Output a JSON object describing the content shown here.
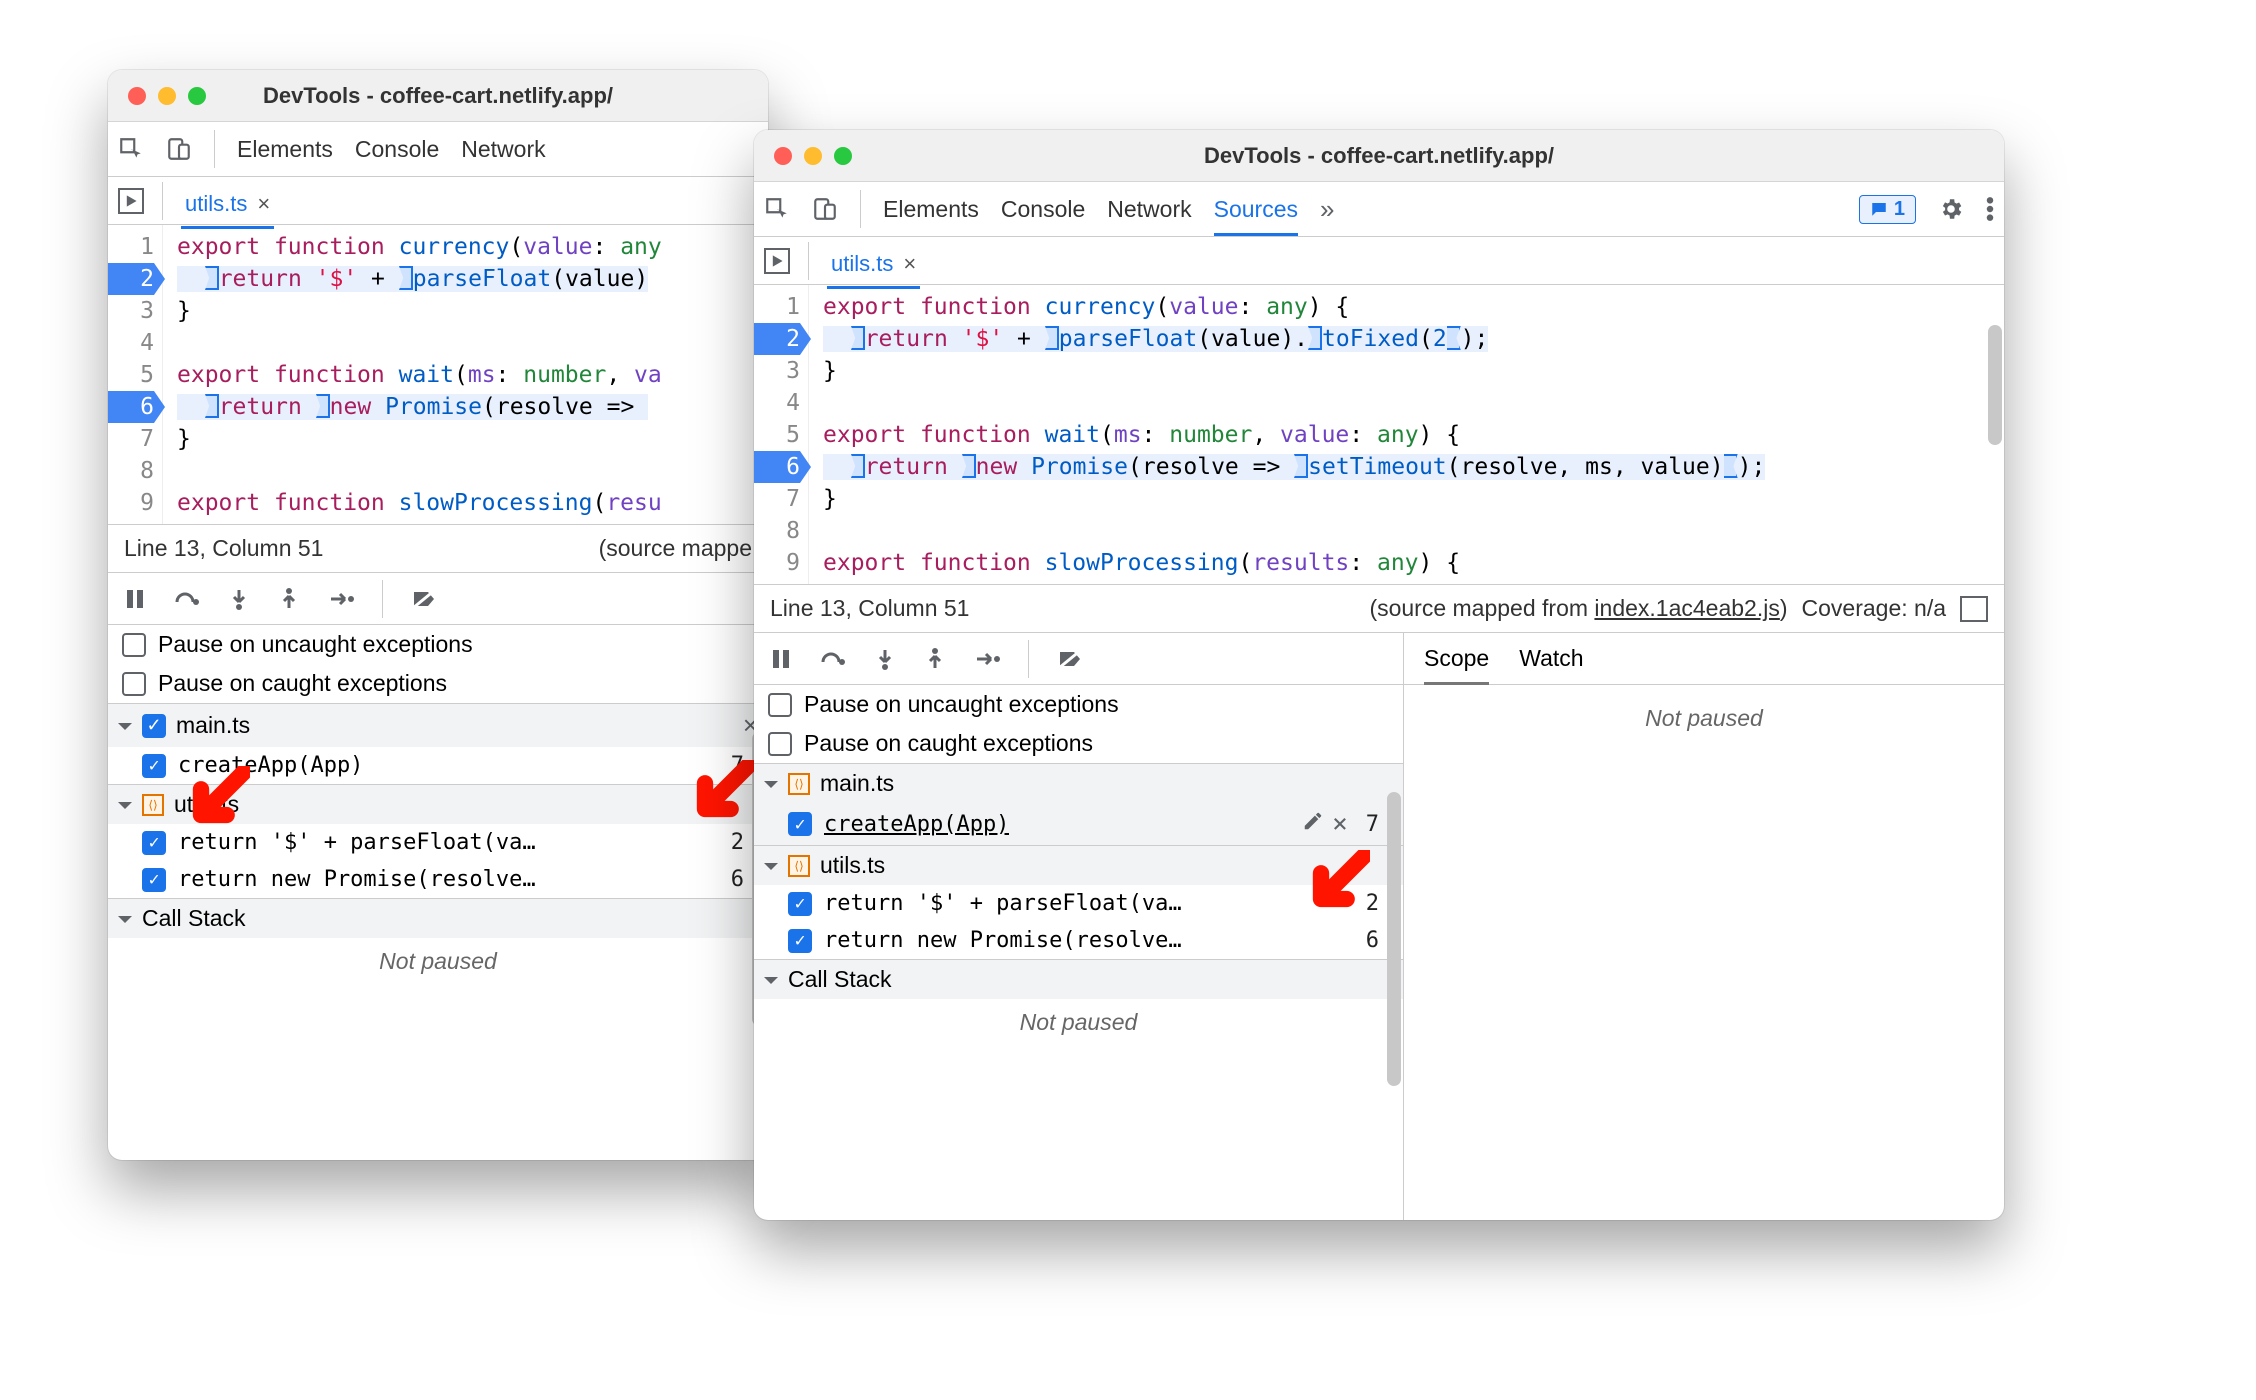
{
  "windows": {
    "left": {
      "title": "DevTools - coffee-cart.netlify.app/"
    },
    "right": {
      "title": "DevTools - coffee-cart.netlify.app/"
    }
  },
  "tabs": {
    "elements": "Elements",
    "console": "Console",
    "network": "Network",
    "sources": "Sources",
    "overflow": "»"
  },
  "issues_badge": "1",
  "file_tab": "utils.ts",
  "code_lines": [
    {
      "n": 1,
      "bp": false
    },
    {
      "n": 2,
      "bp": true
    },
    {
      "n": 3,
      "bp": false
    },
    {
      "n": 4,
      "bp": false
    },
    {
      "n": 5,
      "bp": false
    },
    {
      "n": 6,
      "bp": true
    },
    {
      "n": 7,
      "bp": false
    },
    {
      "n": 8,
      "bp": false
    },
    {
      "n": 9,
      "bp": false
    }
  ],
  "statusbar": {
    "pos": "Line 13, Column 51",
    "mapped_prefix": "(source mapped from ",
    "mapped_link": "index.1ac4eab2.js",
    "mapped_suffix": ")",
    "coverage": "Coverage: n/a",
    "truncated": "(source mappe"
  },
  "pause_uncaught": "Pause on uncaught exceptions",
  "pause_caught": "Pause on caught exceptions",
  "bp_files": {
    "main": "main.ts",
    "utils": "utils.ts"
  },
  "bp_items": {
    "createApp": "createApp(App)",
    "createApp_line": "7",
    "return_parse": "return '$' + parseFloat(va…",
    "return_parse_ln": "2",
    "return_prom": "return new Promise(resolve…",
    "return_prom_ln": "6"
  },
  "call_stack": "Call Stack",
  "not_paused": "Not paused",
  "scope": "Scope",
  "watch": "Watch"
}
